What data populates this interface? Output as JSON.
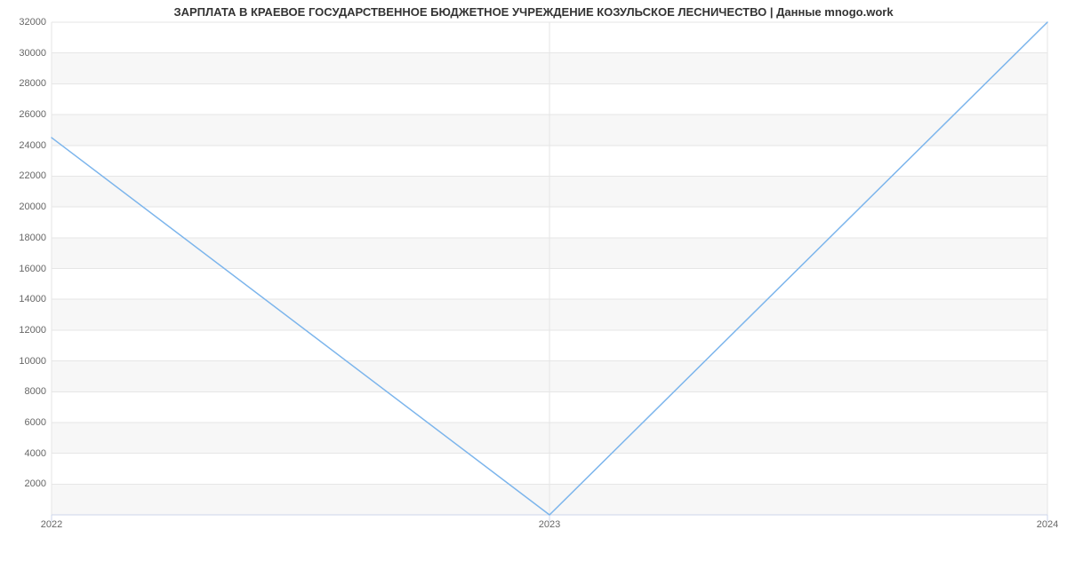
{
  "chart_data": {
    "type": "line",
    "title": "ЗАРПЛАТА В КРАЕВОЕ ГОСУДАРСТВЕННОЕ БЮДЖЕТНОЕ УЧРЕЖДЕНИЕ КОЗУЛЬСКОЕ ЛЕСНИЧЕСТВО | Данные mnogo.work",
    "xlabel": "",
    "ylabel": "",
    "x_categories": [
      "2022",
      "2023",
      "2024"
    ],
    "x": [
      2022,
      2023,
      2024
    ],
    "values": [
      24500,
      0,
      32000
    ],
    "y_ticks": [
      2000,
      4000,
      6000,
      8000,
      10000,
      12000,
      14000,
      16000,
      18000,
      20000,
      22000,
      24000,
      26000,
      28000,
      30000,
      32000
    ],
    "ylim": [
      0,
      32000
    ],
    "xlim": [
      2022,
      2024
    ],
    "colors": {
      "line": "#7cb5ec",
      "band": "#f7f7f7"
    }
  }
}
